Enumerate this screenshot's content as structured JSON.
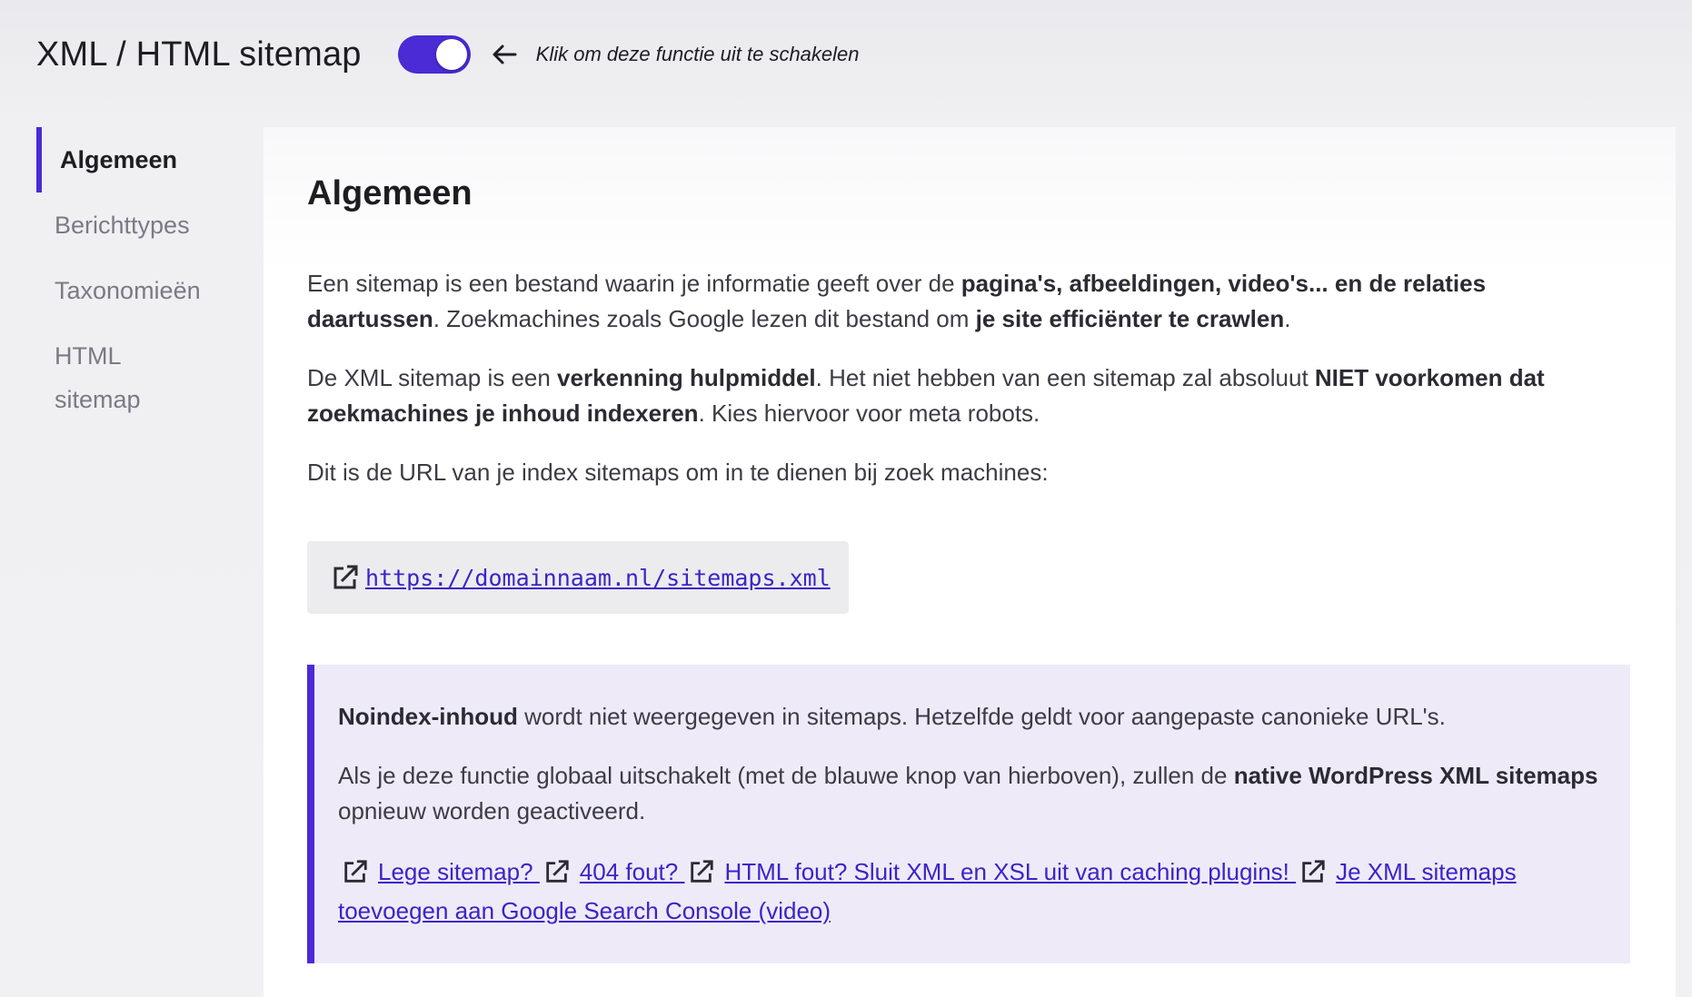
{
  "header": {
    "title": "XML / HTML sitemap",
    "toggle_state": "on",
    "hint": "Klik om deze functie uit te schakelen"
  },
  "sidebar": {
    "items": [
      {
        "label": "Algemeen",
        "active": true
      },
      {
        "label": "Berichttypes",
        "active": false
      },
      {
        "label": "Taxonomieën",
        "active": false
      },
      {
        "label": "HTML sitemap",
        "active": false
      }
    ]
  },
  "main": {
    "heading": "Algemeen",
    "p1": {
      "t1": "Een sitemap is een bestand waarin je informatie geeft over de ",
      "b1": "pagina's, afbeeldingen, video's... en de relaties daartussen",
      "t2": ". Zoekmachines zoals Google lezen dit bestand om ",
      "b2": "je site efficiënter te crawlen",
      "t3": "."
    },
    "p2": {
      "t1": "De XML sitemap is een ",
      "b1": "verkenning hulpmiddel",
      "t2": ". Het niet hebben van een sitemap zal absoluut ",
      "b2": "NIET voorkomen dat zoekmachines je inhoud indexeren",
      "t3": ". Kies hiervoor voor meta robots."
    },
    "p3": "Dit is de URL van je index sitemaps om in te dienen bij zoek machines:",
    "sitemap_url": "https://domainnaam.nl/sitemaps.xml"
  },
  "notice": {
    "p1": {
      "b1": "Noindex-inhoud",
      "t1": " wordt niet weergegeven in sitemaps. Hetzelfde geldt voor aangepaste canonieke URL's."
    },
    "p2": {
      "t1": "Als je deze functie globaal uitschakelt (met de blauwe knop van hierboven), zullen de ",
      "b1": "native WordPress XML sitemaps",
      "t2": " opnieuw worden geactiveerd."
    },
    "links": [
      {
        "label": "Lege sitemap? "
      },
      {
        "label": "404 fout? "
      },
      {
        "label": "HTML fout? Sluit XML en XSL uit van caching plugins! "
      },
      {
        "label": "Je XML sitemaps toevoegen aan Google Search Console (video)"
      }
    ]
  },
  "colors": {
    "accent": "#4a2bd6",
    "link": "#3b24c7",
    "notice_bg": "#efeaf8"
  },
  "icons": {
    "back_arrow": "arrow-left-icon",
    "external": "external-link-icon"
  }
}
